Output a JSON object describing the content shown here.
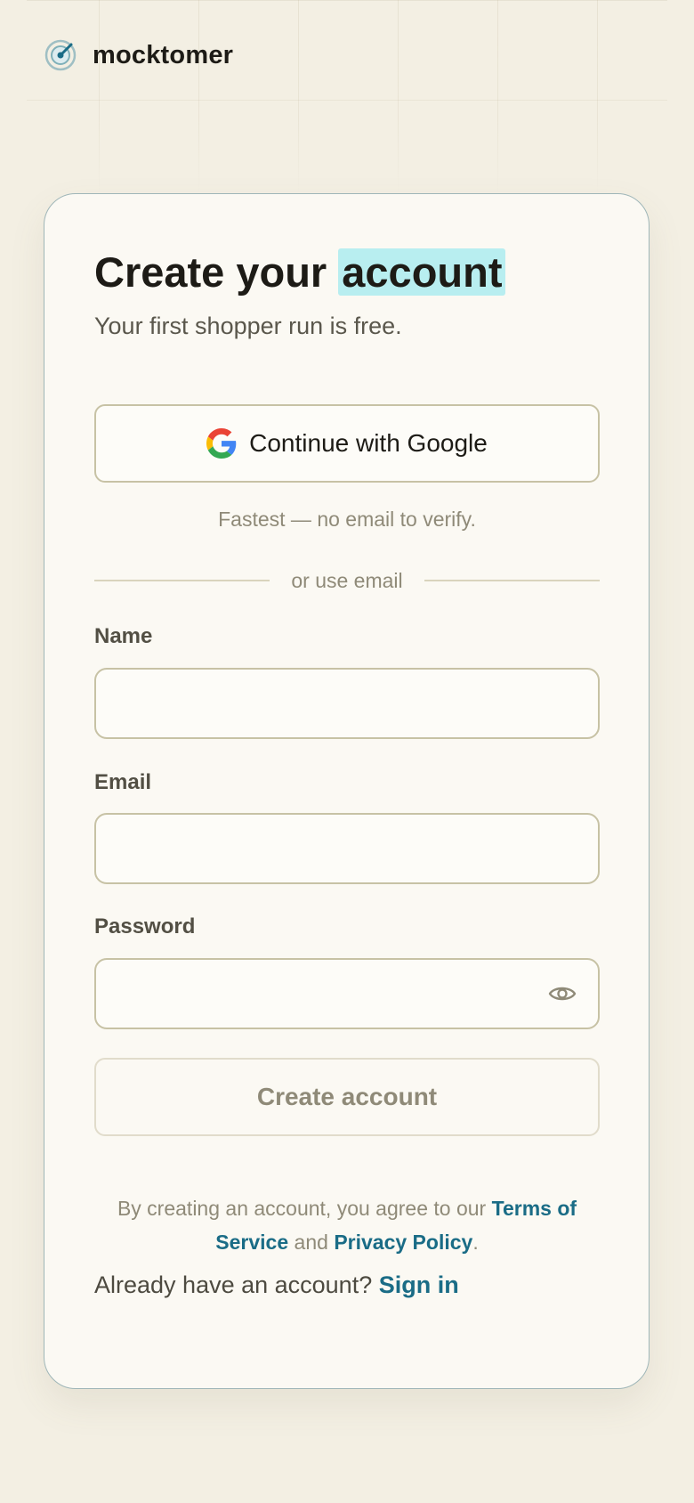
{
  "brand": {
    "name": "mocktomer",
    "logo_icon": "target-icon",
    "accent_color": "#1a6c86"
  },
  "card": {
    "title_prefix": "Create your",
    "title_highlight": "account",
    "subtitle": "Your first shopper run is free.",
    "google_button_label": "Continue with Google",
    "google_icon": "google-g-icon",
    "google_hint": "Fastest — no email to verify.",
    "divider_text": "or use email",
    "fields": {
      "name_label": "Name",
      "email_label": "Email",
      "password_label": "Password",
      "password_toggle_icon": "eye-icon"
    },
    "submit_label": "Create account",
    "legal": {
      "prefix": "By creating an account, you agree to our",
      "terms_link": "Terms of Service",
      "middle": "and",
      "privacy_link": "Privacy Policy",
      "suffix": "."
    },
    "signin": {
      "prompt": "Already have an account?",
      "link": "Sign in"
    }
  },
  "colors": {
    "page_background": "#f3efe3",
    "card_background": "#fbf9f3",
    "highlight": "#b8eef0",
    "link": "#1a6c86"
  }
}
